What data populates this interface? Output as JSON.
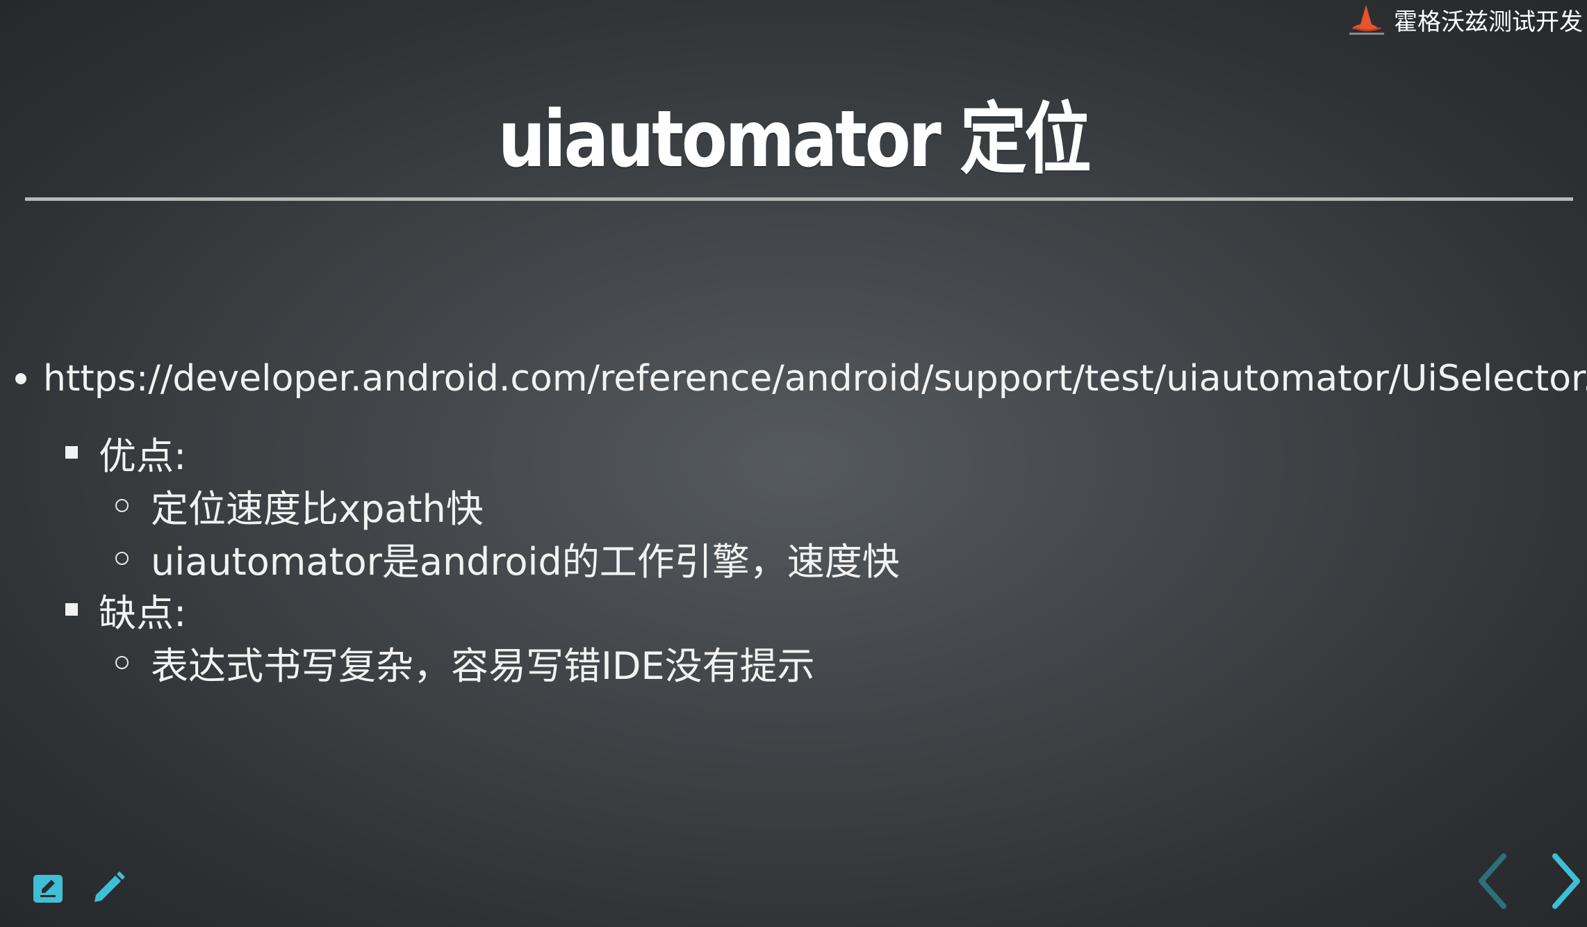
{
  "brand": {
    "text": "霍格沃兹测试开发",
    "icon": "wizard-hat-icon"
  },
  "slide": {
    "title": "uiautomator 定位",
    "url_item": "https://developer.android.com/reference/android/support/test/uiautomator/UiSelector.h",
    "pros_label": "优点:",
    "pros": [
      "定位速度比xpath快",
      "uiautomator是android的工作引擎，速度快"
    ],
    "cons_label": "缺点:",
    "cons": [
      "表达式书写复杂，容易写错IDE没有提示"
    ]
  },
  "controls": {
    "edit_icon": "edit-note-icon",
    "pen_icon": "pencil-icon",
    "prev_icon": "chevron-left-icon",
    "next_icon": "chevron-right-icon"
  },
  "colors": {
    "accent": "#3fbfd6",
    "accent_dim": "#2e6f7a",
    "brand_orange": "#e8542b"
  }
}
